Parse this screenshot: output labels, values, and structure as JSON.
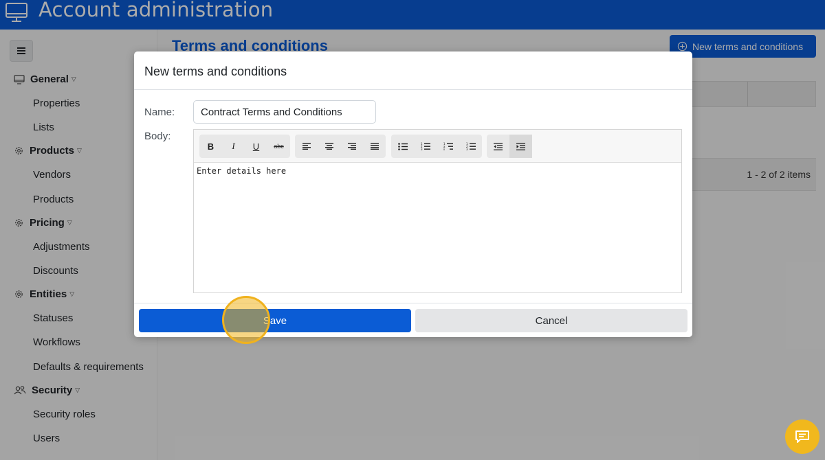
{
  "header": {
    "title": "Account administration",
    "icon": "monitor-icon"
  },
  "sidebar": {
    "menu_icon": "hamburger-icon",
    "groups": [
      {
        "label": "General",
        "icon": "monitor-icon",
        "items": [
          "Properties",
          "Lists"
        ]
      },
      {
        "label": "Products",
        "icon": "gear-icon",
        "items": [
          "Vendors",
          "Products"
        ]
      },
      {
        "label": "Pricing",
        "icon": "gear-icon",
        "items": [
          "Adjustments",
          "Discounts"
        ]
      },
      {
        "label": "Entities",
        "icon": "gear-icon",
        "items": [
          "Statuses",
          "Workflows",
          "Defaults & requirements"
        ]
      },
      {
        "label": "Security",
        "icon": "users-icon",
        "items": [
          "Security roles",
          "Users"
        ]
      }
    ]
  },
  "main": {
    "page_title": "Terms and conditions",
    "new_button": "New terms and conditions",
    "pager_info": "1 - 2 of 2 items"
  },
  "modal": {
    "title": "New terms and conditions",
    "name_label": "Name:",
    "name_value": "Contract Terms and Conditions",
    "body_label": "Body:",
    "body_text": "Enter details here",
    "toolbar": {
      "bold": "B",
      "italic": "I",
      "underline": "U",
      "strikethrough": "abc"
    },
    "save_label": "Save",
    "cancel_label": "Cancel"
  },
  "colors": {
    "brand": "#0b5cd5",
    "accent": "#f1b81d"
  }
}
